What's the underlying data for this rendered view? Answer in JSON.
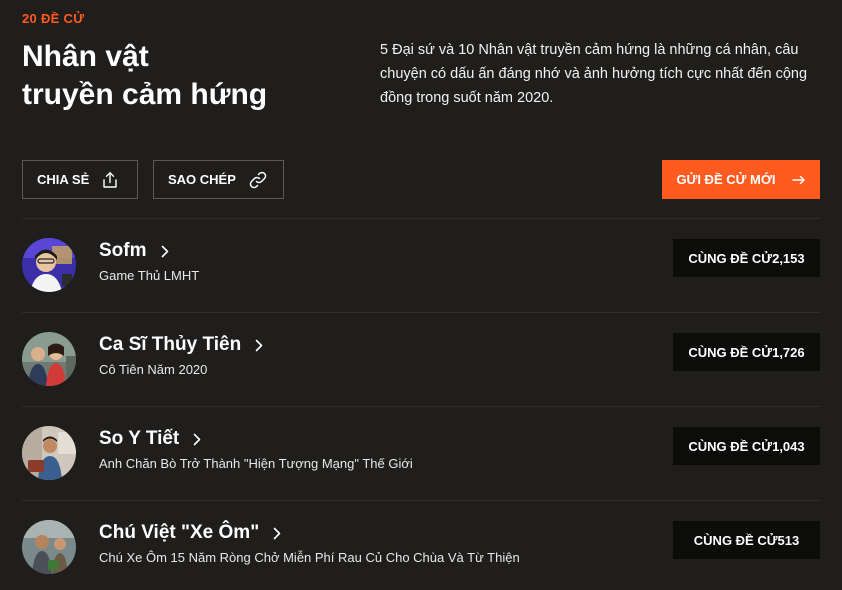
{
  "header": {
    "eyebrow": "20 ĐỀ CỬ",
    "title_line1": "Nhân vật",
    "title_line2": "truyền cảm hứng",
    "description": "5 Đại sứ và 10 Nhân vật truyền cảm hứng là những cá nhân, câu chuyện có dấu ấn đáng nhớ và ảnh hưởng tích cực nhất đến cộng đồng trong suốt năm 2020."
  },
  "actions": {
    "share_label": "CHIA SẺ",
    "copy_label": "SAO CHÉP",
    "submit_label": "GỬI ĐỀ CỬ MỚI"
  },
  "nominees": [
    {
      "name": "Sofm",
      "subtitle": "Game Thủ LMHT",
      "vote_label": "CÙNG ĐỀ CỬ",
      "votes": "2,153"
    },
    {
      "name": "Ca Sĩ Thủy Tiên",
      "subtitle": "Cô Tiên Năm 2020",
      "vote_label": "CÙNG ĐỀ CỬ",
      "votes": "1,726"
    },
    {
      "name": "So Y Tiết",
      "subtitle": "Anh Chăn Bò Trở Thành \"Hiện Tượng Mạng\" Thế Giới",
      "vote_label": "CÙNG ĐỀ CỬ",
      "votes": "1,043"
    },
    {
      "name": "Chú Việt \"Xe Ôm\"",
      "subtitle": "Chú Xe Ôm 15 Năm Ròng Chở Miễn Phí Rau Củ Cho Chùa Và Từ Thiện",
      "vote_label": "CÙNG ĐỀ CỬ",
      "votes": "513"
    }
  ],
  "colors": {
    "background": "#1f1e1c",
    "accent": "#ff5a1f",
    "vote_button": "#0c0c0b"
  }
}
